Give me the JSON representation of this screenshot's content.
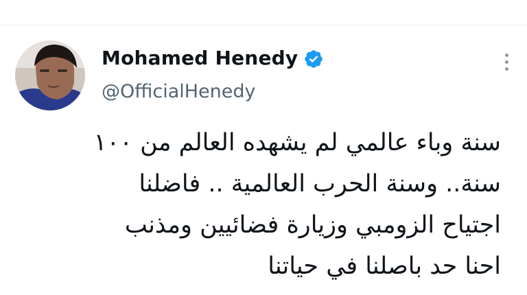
{
  "author": {
    "display_name": "Mohamed Henedy",
    "handle": "@OfficialHenedy",
    "verified": true,
    "avatar_icon": "profile-photo"
  },
  "actions": {
    "more_icon": "more-options-icon"
  },
  "tweet": {
    "lines": [
      "سنة وباء عالمي لم يشهده العالم من ١٠٠",
      "سنة.. وسنة الحرب العالمية .. فاضلنا",
      "اجتياح الزومبي  وزيارة فضائيين ومذنب",
      "احنا حد باصلنا في حياتنا"
    ]
  },
  "colors": {
    "name": "#0f1419",
    "handle": "#536471",
    "verified": "#1d9bf0",
    "text": "#0f1419"
  }
}
